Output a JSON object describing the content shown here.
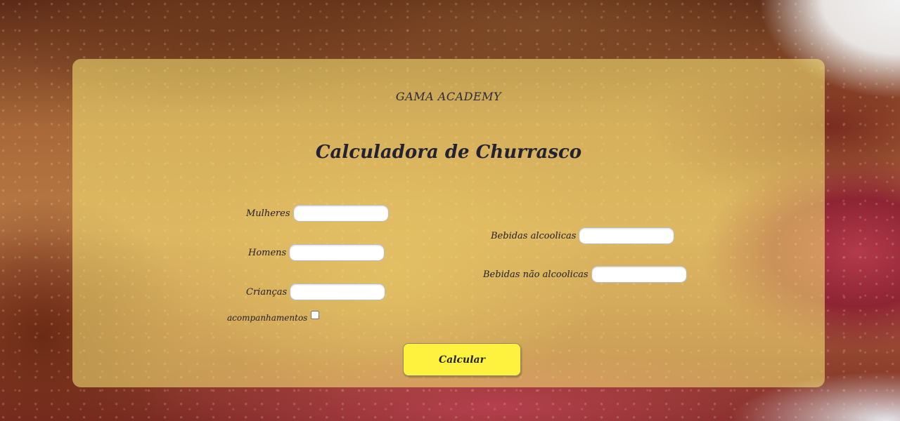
{
  "header": {
    "brand": "GAMA ACADEMY",
    "title": "Calculadora de Churrasco"
  },
  "form": {
    "mulheres_label": "Mulheres",
    "homens_label": "Homens",
    "criancas_label": "Crianças",
    "acompanhamentos_label": "acompanhamentos",
    "bebidas_alcoolicas_label": "Bebidas alcoolicas",
    "bebidas_nao_alcoolicas_label": "Bebidas não alcoolicas",
    "mulheres_value": "",
    "homens_value": "",
    "criancas_value": "",
    "bebidas_alcoolicas_value": "",
    "bebidas_nao_alcoolicas_value": "",
    "acompanhamentos_checked": false
  },
  "actions": {
    "calcular_label": "Calcular"
  },
  "colors": {
    "card_bg": "#fceb78",
    "button_bg": "#fff23e"
  }
}
